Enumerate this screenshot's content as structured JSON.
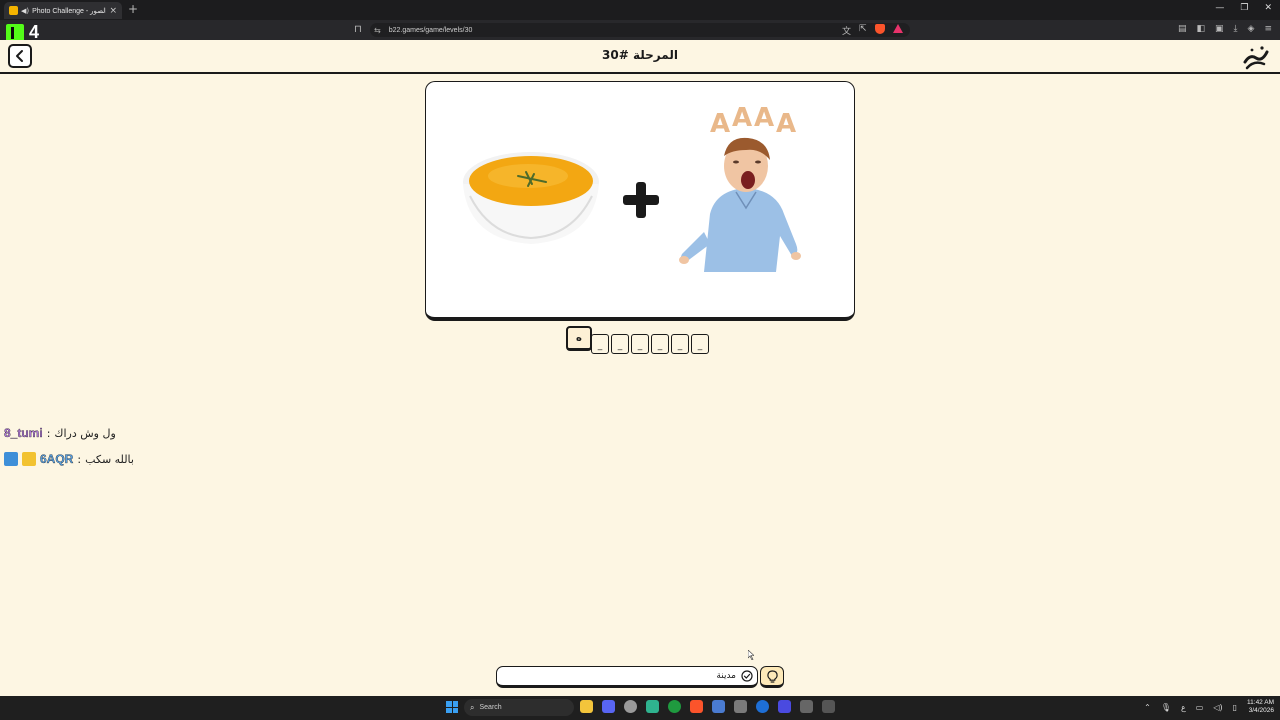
{
  "browser": {
    "tab_title": "Photo Challenge - تحدي الصور",
    "url": "b22.games/game/levels/30",
    "overlay_number": "4"
  },
  "game": {
    "level_title": "المرحلة #30",
    "revealed_letter": "ه",
    "slot_placeholder": "_",
    "input_value": "مدينة"
  },
  "chat": [
    {
      "user": "8_tumi",
      "message": "ول وش دراك",
      "color": "#b07ad8"
    },
    {
      "user": "6AQR",
      "message": "بالله سكب",
      "color": "#5aa0e0"
    }
  ],
  "taskbar": {
    "search_label": "Search",
    "time": "11:42 AM",
    "date": "3/4/2026",
    "lang": "ع"
  },
  "icons": {
    "tab": "audio-icon",
    "back": "chevron-left-icon",
    "hint": "lightbulb-icon",
    "submit": "check-circle-icon"
  },
  "colors": {
    "page_bg": "#fdf6e3",
    "accent": "#1a1a1a",
    "kick_green": "#53fc18"
  }
}
